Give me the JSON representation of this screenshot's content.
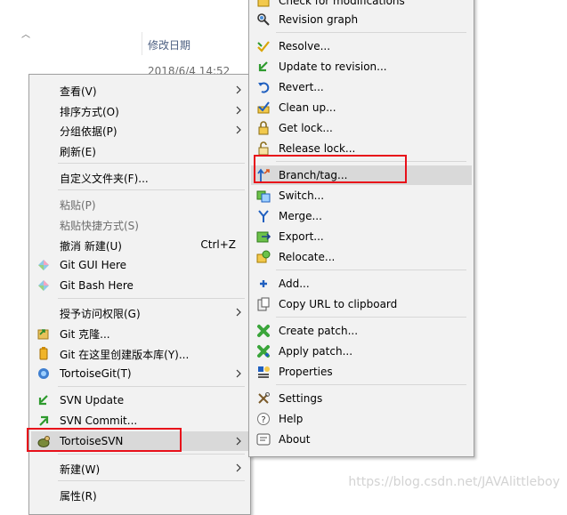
{
  "explorer": {
    "column_header": "修改日期",
    "date_value": "2018/6/4 14:52"
  },
  "left_menu": {
    "items": [
      {
        "label": "查看(V)",
        "submenu": true
      },
      {
        "label": "排序方式(O)",
        "submenu": true
      },
      {
        "label": "分组依据(P)",
        "submenu": true
      },
      {
        "label": "刷新(E)"
      },
      {
        "label": "自定义文件夹(F)..."
      },
      {
        "label": "粘贴(P)",
        "disabled": true
      },
      {
        "label": "粘贴快捷方式(S)",
        "disabled": true
      },
      {
        "label": "撤消 新建(U)",
        "shortcut": "Ctrl+Z"
      },
      {
        "label": "Git GUI Here",
        "icon": "git-diamond-icon"
      },
      {
        "label": "Git Bash Here",
        "icon": "git-diamond-icon"
      },
      {
        "label": "授予访问权限(G)",
        "submenu": true
      },
      {
        "label": "Git 克隆...",
        "icon": "git-clone-icon"
      },
      {
        "label": "Git 在这里创建版本库(Y)...",
        "icon": "git-repo-icon"
      },
      {
        "label": "TortoiseGit(T)",
        "icon": "tortoisegit-icon",
        "submenu": true
      },
      {
        "label": "SVN Update",
        "icon": "svn-update-icon"
      },
      {
        "label": "SVN Commit...",
        "icon": "svn-commit-icon"
      },
      {
        "label": "TortoiseSVN",
        "icon": "tortoisesvn-icon",
        "submenu": true,
        "highlighted": true
      },
      {
        "label": "新建(W)",
        "submenu": true
      },
      {
        "label": "属性(R)"
      }
    ]
  },
  "right_menu": {
    "items": [
      {
        "label": "Check for modifications",
        "icon": "folder-check-icon"
      },
      {
        "label": "Revision graph",
        "icon": "revision-graph-icon"
      },
      {
        "label": "Resolve...",
        "icon": "resolve-icon"
      },
      {
        "label": "Update to revision...",
        "icon": "update-revision-icon"
      },
      {
        "label": "Revert...",
        "icon": "revert-icon"
      },
      {
        "label": "Clean up...",
        "icon": "cleanup-icon"
      },
      {
        "label": "Get lock...",
        "icon": "lock-icon"
      },
      {
        "label": "Release lock...",
        "icon": "unlock-icon"
      },
      {
        "label": "Branch/tag...",
        "icon": "branch-tag-icon",
        "highlighted": true
      },
      {
        "label": "Switch...",
        "icon": "switch-icon"
      },
      {
        "label": "Merge...",
        "icon": "merge-icon"
      },
      {
        "label": "Export...",
        "icon": "export-icon"
      },
      {
        "label": "Relocate...",
        "icon": "relocate-icon"
      },
      {
        "label": "Add...",
        "icon": "add-icon"
      },
      {
        "label": "Copy URL to clipboard",
        "icon": "copy-url-icon"
      },
      {
        "label": "Create patch...",
        "icon": "create-patch-icon"
      },
      {
        "label": "Apply patch...",
        "icon": "apply-patch-icon"
      },
      {
        "label": "Properties",
        "icon": "properties-icon"
      },
      {
        "label": "Settings",
        "icon": "settings-icon"
      },
      {
        "label": "Help",
        "icon": "help-icon"
      },
      {
        "label": "About",
        "icon": "about-icon"
      }
    ]
  },
  "watermark": "https://blog.csdn.net/JAVAlittleboy",
  "colors": {
    "highlight_box": "#e8101a",
    "menu_background": "#f2f2f2",
    "hover_background": "#d9d9d9"
  }
}
